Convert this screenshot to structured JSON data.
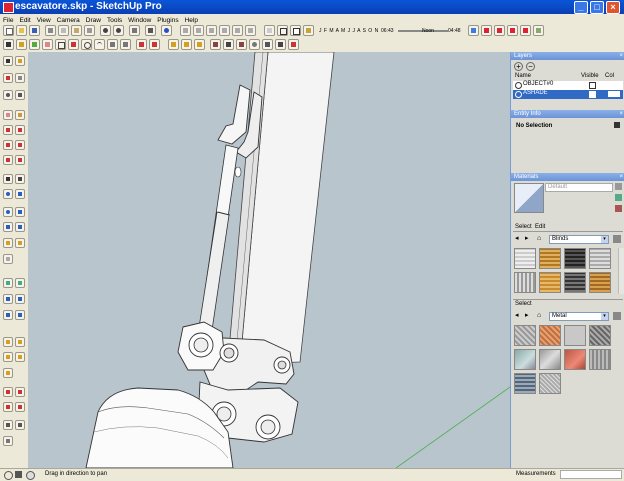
{
  "window": {
    "title": "escavatore.skp - SketchUp Pro",
    "min": "_",
    "max": "□",
    "close": "×"
  },
  "menu": [
    "File",
    "Edit",
    "View",
    "Camera",
    "Draw",
    "Tools",
    "Window",
    "Plugins",
    "Help"
  ],
  "shadow": {
    "months": "J F M A M J J A S O N D",
    "time_start": "06:43",
    "time_mid": "Noon",
    "time_end": "04:48"
  },
  "layers": {
    "title": "Layers",
    "col_name": "Name",
    "col_visible": "Visible",
    "col_color": "Col",
    "rows": [
      {
        "name": "OBJECT#0",
        "selected": false
      },
      {
        "name": "ASHADE",
        "selected": true
      }
    ]
  },
  "entity_info": {
    "title": "Entity Info",
    "text": "No Selection"
  },
  "materials": {
    "title": "Materials",
    "preview_name": "Default",
    "tab_select": "Select",
    "tab_edit": "Edit",
    "category1": "Blinds",
    "secondary_label": "Select",
    "category2": "Metal"
  },
  "status": {
    "message": "Drag in direction to pan",
    "measurements_label": "Measurements"
  },
  "colors": {
    "titlebar": "#0a49c6",
    "panel_header": "#7aa2e0",
    "viewport_bg": "#b8c5cc",
    "selection": "#316ac5"
  }
}
